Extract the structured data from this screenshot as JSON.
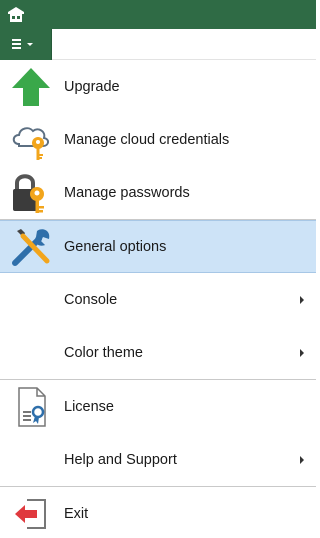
{
  "menu": {
    "items": [
      {
        "label": "Upgrade",
        "icon": "upgrade-arrow-icon",
        "submenu": false,
        "selected": false
      },
      {
        "label": "Manage cloud credentials",
        "icon": "cloud-key-icon",
        "submenu": false,
        "selected": false
      },
      {
        "label": "Manage passwords",
        "icon": "lock-key-icon",
        "submenu": false,
        "selected": false
      },
      {
        "label": "General options",
        "icon": "wrench-screwdriver-icon",
        "submenu": false,
        "selected": true
      },
      {
        "label": "Console",
        "icon": "",
        "submenu": true,
        "selected": false
      },
      {
        "label": "Color theme",
        "icon": "",
        "submenu": true,
        "selected": false
      },
      {
        "label": "License",
        "icon": "license-document-icon",
        "submenu": false,
        "selected": false
      },
      {
        "label": "Help and Support",
        "icon": "",
        "submenu": true,
        "selected": false
      },
      {
        "label": "Exit",
        "icon": "exit-door-icon",
        "submenu": false,
        "selected": false
      }
    ]
  },
  "colors": {
    "titlebar": "#2f6b45",
    "selected_bg": "#cde3f7",
    "upgrade_green": "#3aa84a",
    "exit_red": "#e0393e",
    "key_gold": "#f2a51c"
  }
}
